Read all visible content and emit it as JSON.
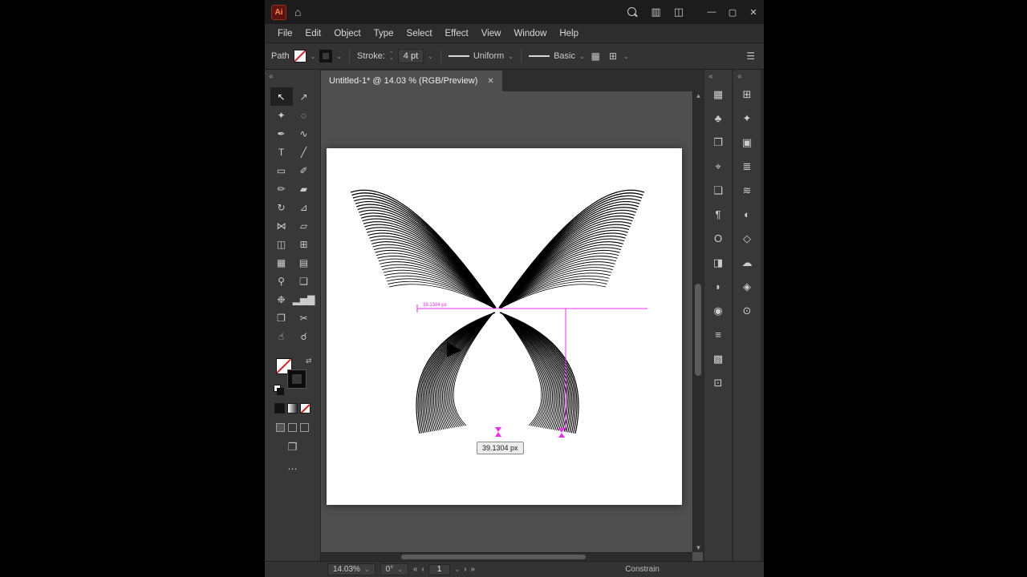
{
  "colors": {
    "accent": "#f32cf3",
    "artboard": "#ffffff",
    "ink": "#000000"
  },
  "titlebar": {
    "logo": "Ai",
    "home_icon": "⌂",
    "layout1_icon": "▥",
    "layout2_icon": "◫",
    "min": "—",
    "max": "▢",
    "close": "✕"
  },
  "menubar": {
    "items": [
      "File",
      "Edit",
      "Object",
      "Type",
      "Select",
      "Effect",
      "View",
      "Window",
      "Help"
    ]
  },
  "controlbar": {
    "selection_label": "Path",
    "stroke_label": "Stroke:",
    "stroke_value": "4 pt",
    "width_profile": "Uniform",
    "brush_definition": "Basic",
    "grid_icon": "▦",
    "graph_icon": "⊞",
    "menu_icon": "☰"
  },
  "doc": {
    "tab_title": "Untitled-1* @ 14.03 % (RGB/Preview)",
    "close_icon": "✕"
  },
  "measure": {
    "tooltip": "39.1304 px",
    "inline_label": "39.1304 px"
  },
  "toolbar_extras": {
    "collapse": "«",
    "ellipsis": "⋯"
  },
  "tools": [
    {
      "name": "selection-tool",
      "glyph": "↖"
    },
    {
      "name": "direct-selection-tool",
      "glyph": "↗"
    },
    {
      "name": "magic-wand-tool",
      "glyph": "✦"
    },
    {
      "name": "lasso-tool",
      "glyph": "◌"
    },
    {
      "name": "pen-tool",
      "glyph": "✒"
    },
    {
      "name": "curvature-tool",
      "glyph": "∿"
    },
    {
      "name": "type-tool",
      "glyph": "T"
    },
    {
      "name": "line-segment-tool",
      "glyph": "╱"
    },
    {
      "name": "rectangle-tool",
      "glyph": "▭"
    },
    {
      "name": "paintbrush-tool",
      "glyph": "✐"
    },
    {
      "name": "pencil-tool",
      "glyph": "✏"
    },
    {
      "name": "eraser-tool",
      "glyph": "▰"
    },
    {
      "name": "rotate-tool",
      "glyph": "↻"
    },
    {
      "name": "scale-tool",
      "glyph": "⊿"
    },
    {
      "name": "width-tool",
      "glyph": "⋈"
    },
    {
      "name": "free-transform-tool",
      "glyph": "▱"
    },
    {
      "name": "shape-builder-tool",
      "glyph": "◫"
    },
    {
      "name": "perspective-grid-tool",
      "glyph": "⊞"
    },
    {
      "name": "mesh-tool",
      "glyph": "▦"
    },
    {
      "name": "gradient-tool",
      "glyph": "▤"
    },
    {
      "name": "eyedropper-tool",
      "glyph": "⚲"
    },
    {
      "name": "blend-tool",
      "glyph": "❏"
    },
    {
      "name": "symbol-sprayer-tool",
      "glyph": "❉"
    },
    {
      "name": "column-graph-tool",
      "glyph": "▂▅▇"
    },
    {
      "name": "artboard-tool",
      "glyph": "❐"
    },
    {
      "name": "slice-tool",
      "glyph": "✂"
    },
    {
      "name": "hand-tool",
      "glyph": "☝"
    },
    {
      "name": "zoom-tool",
      "glyph": "☌"
    }
  ],
  "panels": {
    "collapse": "«",
    "col1": [
      {
        "name": "panel-icon-artboards",
        "glyph": "▦"
      },
      {
        "name": "panel-icon-pattern",
        "glyph": "♣"
      },
      {
        "name": "panel-icon-export",
        "glyph": "❐"
      },
      {
        "name": "panel-icon-navigator",
        "glyph": "⌖"
      },
      {
        "name": "panel-icon-symbols",
        "glyph": "❏"
      },
      {
        "name": "panel-icon-paragraph",
        "glyph": "¶"
      },
      {
        "name": "panel-icon-opentype",
        "glyph": "O"
      },
      {
        "name": "panel-icon-transform",
        "glyph": "◨"
      },
      {
        "name": "panel-icon-pathfinder",
        "glyph": "◗"
      },
      {
        "name": "panel-icon-color",
        "glyph": "◉"
      },
      {
        "name": "panel-icon-properties",
        "glyph": "≡"
      },
      {
        "name": "panel-icon-transparency",
        "glyph": "▩"
      },
      {
        "name": "panel-icon-links",
        "glyph": "⊡"
      }
    ],
    "col2": [
      {
        "name": "panel-icon-grid",
        "glyph": "⊞"
      },
      {
        "name": "panel-icon-magic",
        "glyph": "✦"
      },
      {
        "name": "panel-icon-swatches",
        "glyph": "▣"
      },
      {
        "name": "panel-icon-stroke",
        "glyph": "≣"
      },
      {
        "name": "panel-icon-brushes",
        "glyph": "≋"
      },
      {
        "name": "panel-icon-appearance",
        "glyph": "◐"
      },
      {
        "name": "panel-icon-graphic-styles",
        "glyph": "◇"
      },
      {
        "name": "panel-icon-libraries",
        "glyph": "☁"
      },
      {
        "name": "panel-icon-layers",
        "glyph": "◈"
      },
      {
        "name": "panel-icon-asset-export",
        "glyph": "⊙"
      }
    ]
  },
  "statusbar": {
    "zoom": "14.03%",
    "rotation": "0°",
    "nav_first": "«",
    "nav_prev": "‹",
    "artboard_number": "1",
    "nav_next": "›",
    "nav_last": "»",
    "constrain_label": "Constrain"
  }
}
